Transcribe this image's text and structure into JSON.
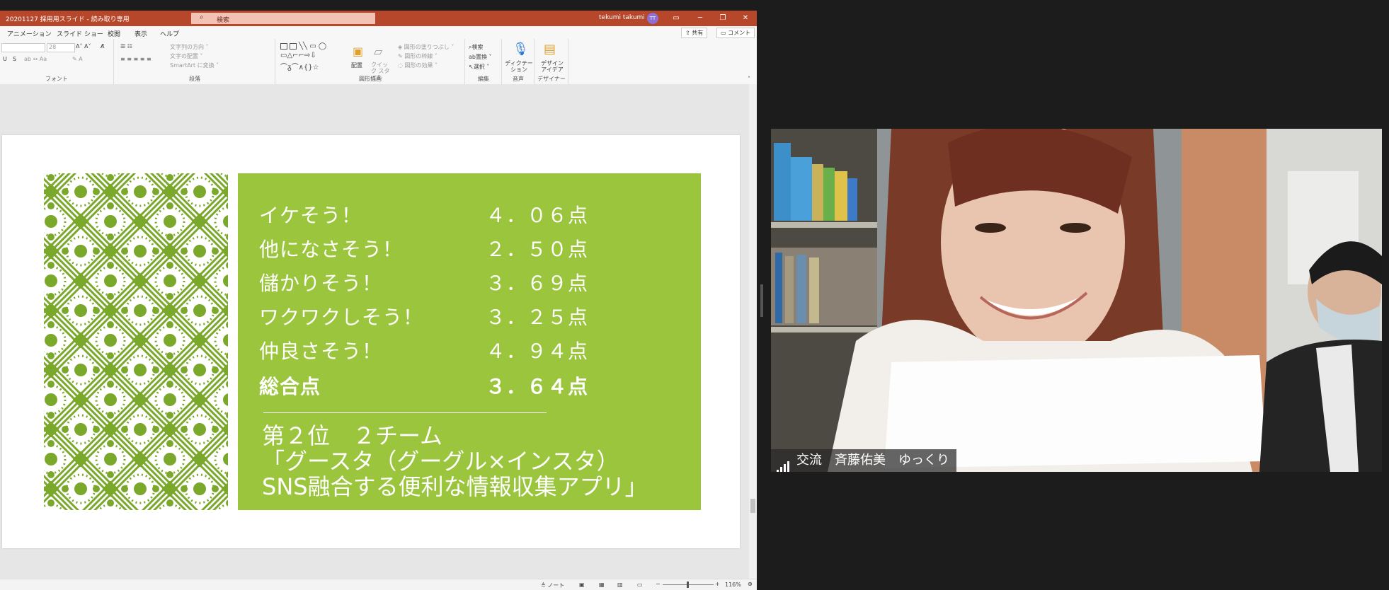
{
  "window": {
    "title": "20201127 採用用スライド - 読み取り専用",
    "search_placeholder": "検索",
    "user_name": "tekumi takumi",
    "user_initials": "TT",
    "controls": {
      "ribbon_display": "▭",
      "minimize": "─",
      "restore": "❐",
      "close": "✕"
    }
  },
  "menu": {
    "tabs": [
      "アニメーション",
      "スライド ショー",
      "校閲",
      "表示",
      "ヘルプ"
    ],
    "share_label": "共有",
    "comment_label": "コメント"
  },
  "ribbon": {
    "groups": [
      "フォント",
      "段落",
      "図形描画",
      "編集",
      "音声",
      "デザイナー"
    ],
    "paragraph_items": [
      "文字列の方向",
      "文字の配置",
      "SmartArt に変換"
    ],
    "drawing_buttons": [
      "配置",
      "クイック スタイル"
    ],
    "drawing_items": [
      "図形の塗りつぶし",
      "図形の枠線",
      "図形の効果"
    ],
    "edit_items": [
      "検索",
      "置換",
      "選択"
    ],
    "dictate_label": "ディクテーション",
    "designer_label": "デザイン アイデア",
    "font_size": "28"
  },
  "slide": {
    "scores": [
      {
        "label": "イケそう！",
        "value": "４．０６点"
      },
      {
        "label": "他になさそう！",
        "value": "２．５０点"
      },
      {
        "label": "儲かりそう！",
        "value": "３．６９点"
      },
      {
        "label": "ワクワクしそう！",
        "value": "３．２５点"
      },
      {
        "label": "仲良さそう！",
        "value": "４．９４点"
      }
    ],
    "total": {
      "label": "総合点",
      "value": "３．６４点"
    },
    "result_lines": [
      "第２位　２チーム",
      "「グースタ（グーグル×インスタ）",
      "SNS融合する便利な情報収集アプリ」"
    ],
    "colors": {
      "green": "#9bc53d",
      "pattern_green": "#7aa82a"
    }
  },
  "status": {
    "notes_label": "ノート",
    "zoom": "116%"
  },
  "video": {
    "participant_name": "交流　斉藤佑美　ゆっくり"
  }
}
